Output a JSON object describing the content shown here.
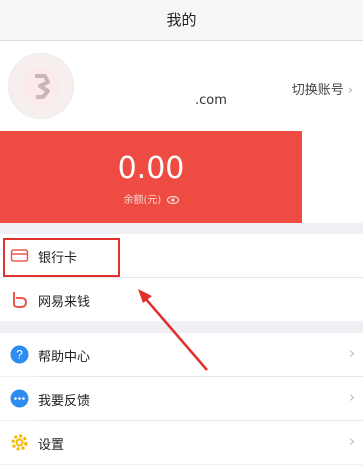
{
  "header": {
    "title": "我的"
  },
  "profile": {
    "account_suffix": ".com",
    "switch_label": "切换账号",
    "chevron": "›"
  },
  "balance": {
    "amount": "0.00",
    "label": "余额(元)"
  },
  "menu": {
    "bank_card": "银行卡",
    "wangyi_money": "网易来钱",
    "help": "帮助中心",
    "feedback": "我要反馈",
    "settings": "设置",
    "chevron": "›"
  },
  "colors": {
    "brand_red": "#ee4c42",
    "highlight_red": "#e0322d",
    "help_blue": "#2d8cf0",
    "settings_yellow": "#f5b800"
  }
}
